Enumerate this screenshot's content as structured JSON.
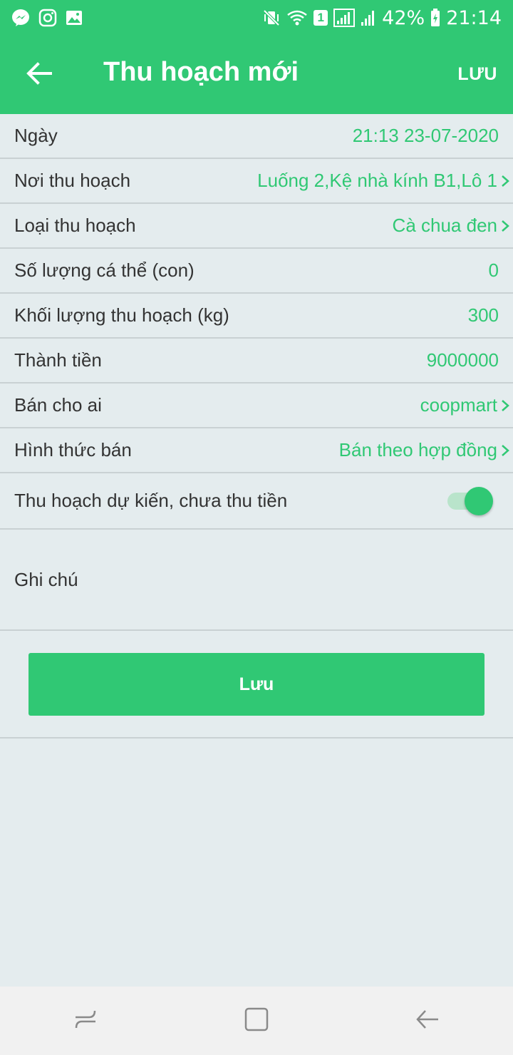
{
  "status_bar": {
    "battery": "42%",
    "time": "21:14",
    "sim_badge": "1"
  },
  "app_bar": {
    "title": "Thu hoạch mới",
    "action_label": "LƯU"
  },
  "form": {
    "date": {
      "label": "Ngày",
      "value": "21:13  23-07-2020"
    },
    "location": {
      "label": "Nơi thu hoạch",
      "value": "Luống 2,Kệ nhà kính  B1,Lô 1"
    },
    "harvest_type": {
      "label": "Loại thu hoạch",
      "value": "Cà chua đen"
    },
    "individual_count": {
      "label": "Số lượng cá thể (con)",
      "value": "0"
    },
    "weight": {
      "label": "Khối lượng thu hoạch (kg)",
      "value": "300"
    },
    "amount": {
      "label": "Thành tiền",
      "value": "9000000"
    },
    "buyer": {
      "label": "Bán cho ai",
      "value": "coopmart"
    },
    "sale_method": {
      "label": "Hình thức bán",
      "value": "Bán theo hợp đồng"
    },
    "expected_unpaid": {
      "label": "Thu hoạch dự kiến, chưa thu tiền",
      "checked": true
    },
    "note": {
      "label": "Ghi chú"
    }
  },
  "save_button": {
    "label": "Lưu"
  },
  "colors": {
    "primary": "#30c874",
    "background": "#e4ecee",
    "divider": "#c9d1d3",
    "text": "#333333"
  }
}
